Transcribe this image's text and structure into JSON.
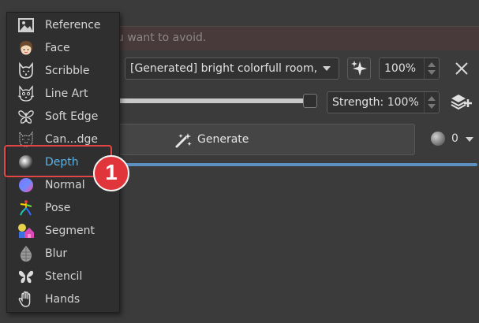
{
  "negative_prompt": {
    "placeholder_visible": "u want to avoid."
  },
  "control_layer": {
    "image_select": {
      "value": "[Generated] bright colorfull room,"
    },
    "strength_top": {
      "value": "100%"
    },
    "strength_slider": {
      "label": "Strength: 100%",
      "level": 1.0
    }
  },
  "generate": {
    "label": "Generate"
  },
  "seed": {
    "value": "0"
  },
  "progress": {
    "level": 1.0
  },
  "menu": {
    "items": [
      {
        "label": "Reference",
        "icon": "image-icon"
      },
      {
        "label": "Face",
        "icon": "face-icon"
      },
      {
        "label": "Scribble",
        "icon": "cat-scribble-icon"
      },
      {
        "label": "Line Art",
        "icon": "cat-lineart-icon"
      },
      {
        "label": "Soft Edge",
        "icon": "butterfly-outline-icon"
      },
      {
        "label": "Can...dge",
        "icon": "cat-canny-icon"
      },
      {
        "label": "Depth",
        "icon": "depth-sphere-icon"
      },
      {
        "label": "Normal",
        "icon": "normal-sphere-icon"
      },
      {
        "label": "Pose",
        "icon": "pose-icon"
      },
      {
        "label": "Segment",
        "icon": "segment-icon"
      },
      {
        "label": "Blur",
        "icon": "blur-icon"
      },
      {
        "label": "Stencil",
        "icon": "stencil-butterfly-icon"
      },
      {
        "label": "Hands",
        "icon": "hand-icon"
      }
    ],
    "selected_index": 6
  },
  "annotation": {
    "step": "1",
    "color": "#e24545"
  },
  "colors": {
    "accent": "#5ab4e8",
    "progress": "#5d8fc0",
    "background": "#3b3b3b"
  }
}
